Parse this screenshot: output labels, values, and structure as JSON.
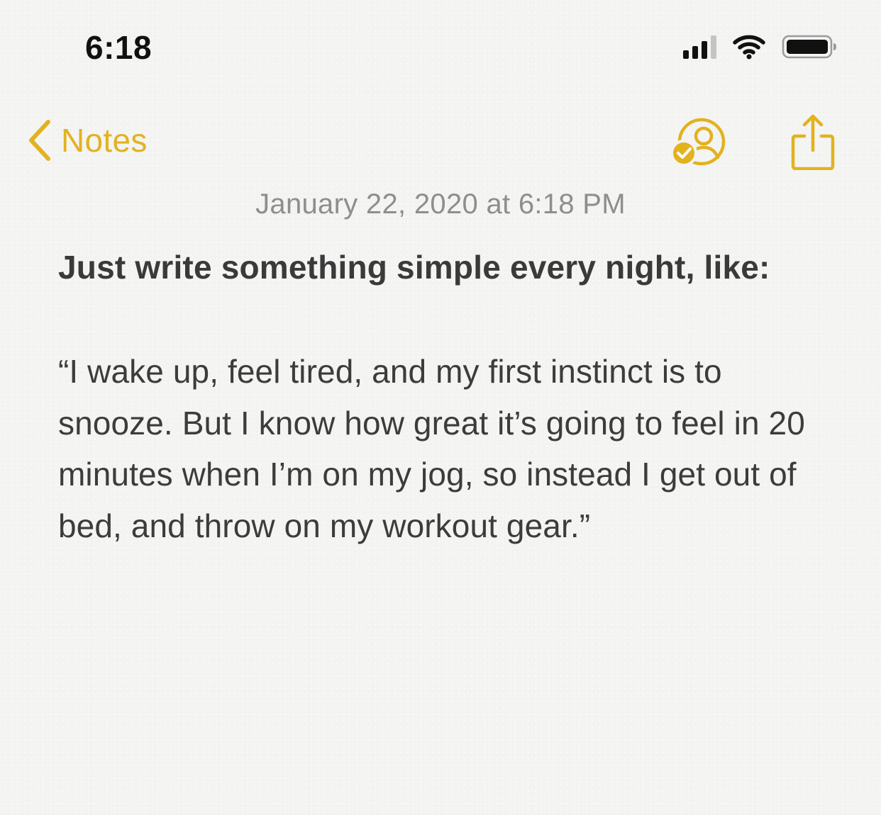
{
  "status_bar": {
    "time": "6:18",
    "signal_icon": "cellular-signal-icon",
    "wifi_icon": "wifi-icon",
    "battery_icon": "battery-icon"
  },
  "nav": {
    "back_label": "Notes",
    "back_icon": "chevron-left-icon",
    "collaborate_icon": "add-people-icon",
    "share_icon": "share-icon",
    "accent_color": "#e2b21f"
  },
  "note": {
    "date": "January 22, 2020 at 6:18 PM",
    "title": "Just write something simple every night, like:",
    "body": "“I wake up, feel tired, and my first instinct is to snooze. But I know how great it’s going to feel in 20 minutes when I’m on my jog, so instead I get out of bed, and throw on my workout gear.”"
  }
}
